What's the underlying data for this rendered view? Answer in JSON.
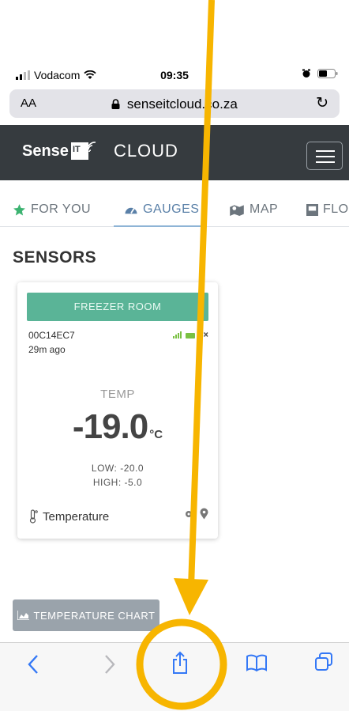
{
  "status_bar": {
    "carrier": "Vodacom",
    "time": "09:35"
  },
  "browser": {
    "text_size_label": "AA",
    "url": "senseitcloud.co.za"
  },
  "app": {
    "logo_text": "Sense",
    "logo_box_text": "IT",
    "logo_cloud_text": "CLOUD"
  },
  "tabs": [
    {
      "label": "FOR YOU",
      "icon": "star-icon"
    },
    {
      "label": "GAUGES",
      "icon": "gauge-icon",
      "active": true
    },
    {
      "label": "MAP",
      "icon": "map-icon"
    },
    {
      "label": "FLO",
      "icon": "floorplan-icon"
    }
  ],
  "section_title": "SENSORS",
  "card": {
    "title": "FREEZER ROOM",
    "device_id": "00C14EC7",
    "last_seen": "29m ago",
    "metric": "TEMP",
    "value": "-19.0",
    "unit": "°C",
    "low": "LOW: -20.0",
    "high": "HIGH: -5.0",
    "sensor_type": "Temperature"
  },
  "chart_button": {
    "label": "TEMPERATURE CHART"
  },
  "colors": {
    "header_bg": "#363b3f",
    "card_header": "#5ab497",
    "active_tab": "#5a80a8",
    "signal_green": "#7ac143",
    "annotation": "#f7b500"
  }
}
